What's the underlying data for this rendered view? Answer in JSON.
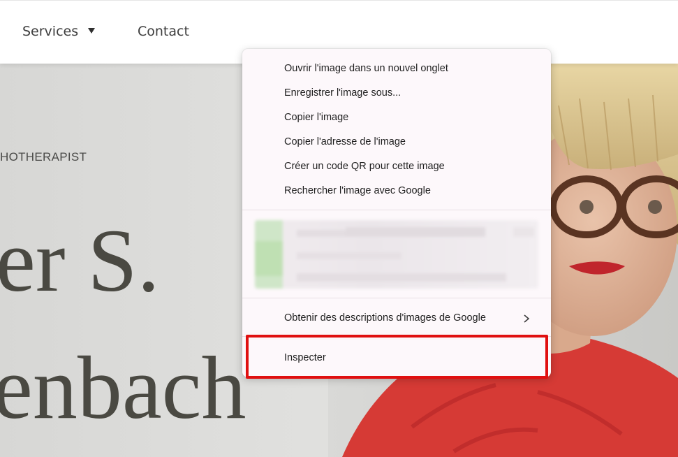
{
  "nav": {
    "services_label": "Services",
    "contact_label": "Contact"
  },
  "hero": {
    "eyebrow": "HOTHERAPIST",
    "name_line_1": "er S.",
    "name_line_2": "enbach"
  },
  "context_menu": {
    "items": [
      {
        "label": "Ouvrir l'image dans un nouvel onglet"
      },
      {
        "label": "Enregistrer l'image sous..."
      },
      {
        "label": "Copier l'image"
      },
      {
        "label": "Copier l'adresse de l'image"
      },
      {
        "label": "Créer un code QR pour cette image"
      },
      {
        "label": "Rechercher l'image avec Google"
      }
    ],
    "descriptions_label": "Obtenir des descriptions d'images de Google",
    "inspect_label": "Inspecter"
  },
  "colors": {
    "highlight": "#e01010",
    "menu_background": "#fdf8fb",
    "header_background": "#ffffff",
    "hero_text": "#4a4942"
  },
  "icons": {
    "services_dropdown": "caret-down-icon",
    "submenu_arrow": "chevron-right-icon"
  }
}
